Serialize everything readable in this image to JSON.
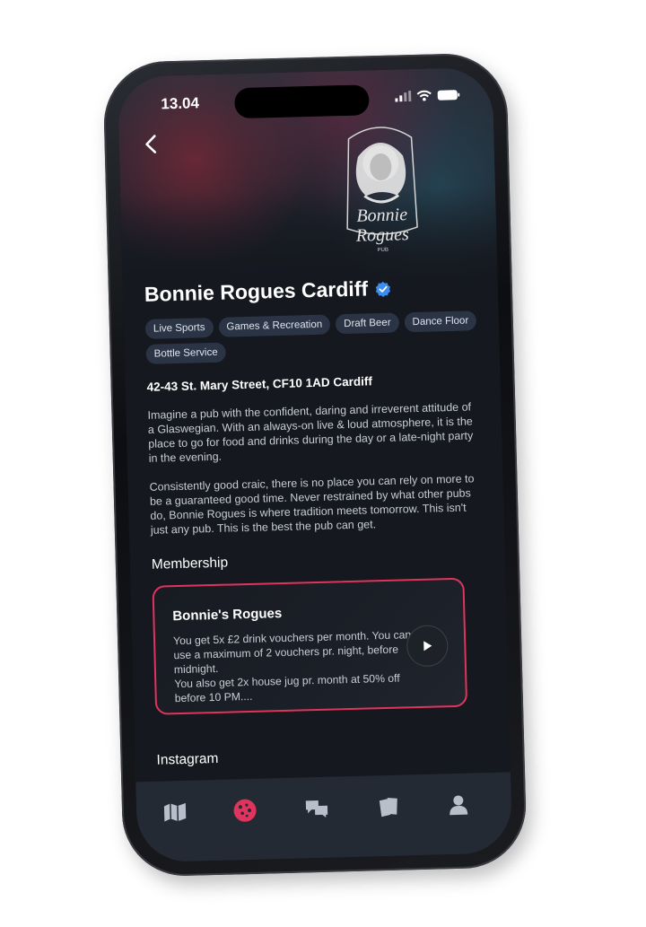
{
  "status_bar": {
    "time": "13.04"
  },
  "venue": {
    "name": "Bonnie Rogues Cardiff",
    "logo_text": "Bonnie Rogues PUB",
    "tags": [
      "Live Sports",
      "Games & Recreation",
      "Draft Beer",
      "Dance Floor",
      "Bottle Service"
    ],
    "address": "42-43 St. Mary Street, CF10 1AD Cardiff",
    "description": [
      "Imagine a pub with the confident, daring and irreverent attitude of a Glaswegian. With an always-on live & loud atmosphere, it is the place to go for food and drinks during the day or a late-night party in the evening.",
      "Consistently good craic, there is no place you can rely on more to be a guaranteed good time. Never restrained by what other pubs do, Bonnie Rogues is where tradition meets tomorrow. This isn't just any pub. This is the best the pub can get."
    ]
  },
  "membership": {
    "heading": "Membership",
    "card_title": "Bonnie's Rogues",
    "card_text": "You get 5x £2 drink vouchers per month. You can use a maximum of 2 vouchers pr. night, before midnight.\nYou also get 2x house jug pr. month at 50% off before 10 PM....",
    "accent": "#e0345e"
  },
  "instagram": {
    "heading": "Instagram"
  },
  "tabbar": {
    "items": [
      "map-icon",
      "explore-icon",
      "chat-icon",
      "tickets-icon",
      "profile-icon"
    ],
    "active": "explore-icon",
    "active_color": "#e0345e"
  }
}
